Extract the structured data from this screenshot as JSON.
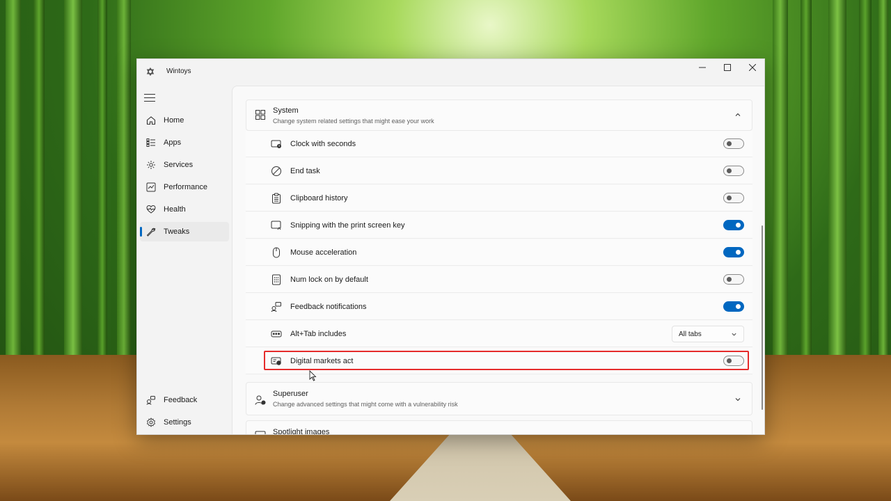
{
  "window": {
    "title": "Wintoys",
    "minimize_icon": "minimize-icon",
    "maximize_icon": "maximize-icon",
    "close_icon": "close-icon"
  },
  "nav": {
    "menu_icon": "hamburger-icon",
    "items": [
      {
        "label": "Home",
        "icon": "home-icon"
      },
      {
        "label": "Apps",
        "icon": "apps-icon"
      },
      {
        "label": "Services",
        "icon": "services-icon"
      },
      {
        "label": "Performance",
        "icon": "performance-icon"
      },
      {
        "label": "Health",
        "icon": "health-icon"
      },
      {
        "label": "Tweaks",
        "icon": "tweaks-icon",
        "active": true
      }
    ],
    "footer": [
      {
        "label": "Feedback",
        "icon": "feedback-icon"
      },
      {
        "label": "Settings",
        "icon": "settings-icon"
      }
    ]
  },
  "system_section": {
    "title": "System",
    "subtitle": "Change system related settings that might ease your work",
    "expanded": true,
    "rows": [
      {
        "label": "Clock with seconds",
        "icon": "clock-icon",
        "toggle": false
      },
      {
        "label": "End task",
        "icon": "end-task-icon",
        "toggle": false
      },
      {
        "label": "Clipboard history",
        "icon": "clipboard-icon",
        "toggle": false
      },
      {
        "label": "Snipping with the print screen key",
        "icon": "snipping-icon",
        "toggle": true
      },
      {
        "label": "Mouse acceleration",
        "icon": "mouse-icon",
        "toggle": true
      },
      {
        "label": "Num lock on by default",
        "icon": "numpad-icon",
        "toggle": false
      },
      {
        "label": "Feedback notifications",
        "icon": "feedback-notify-icon",
        "toggle": true
      },
      {
        "label": "Alt+Tab includes",
        "icon": "alt-tab-icon",
        "dropdown": "All tabs"
      },
      {
        "label": "Digital markets act",
        "icon": "dma-icon",
        "toggle": false
      }
    ]
  },
  "superuser_section": {
    "title": "Superuser",
    "subtitle": "Change advanced settings that might come with a vulnerability risk",
    "expanded": false
  },
  "spotlight_section": {
    "title": "Spotlight images"
  },
  "colors": {
    "accent": "#0067c0",
    "highlight": "#e52b2b"
  }
}
